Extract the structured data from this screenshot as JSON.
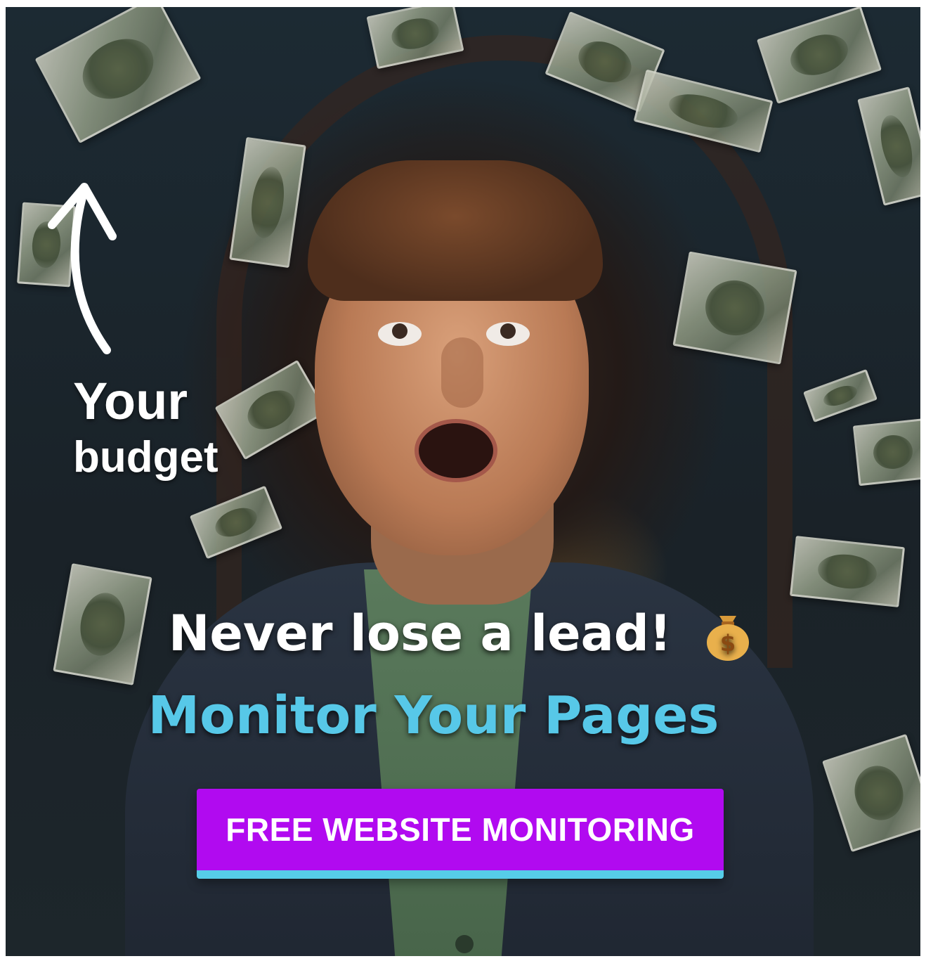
{
  "ad": {
    "arrow_label_line1": "Your",
    "arrow_label_line2": "budget",
    "headline": "Never lose a lead!",
    "headline_emoji": "money-bag",
    "subheadline": "Monitor Your Pages",
    "cta_label": "FREE WEBSITE MONITORING"
  },
  "colors": {
    "subheadline": "#57c8e8",
    "cta_background": "#b10af0",
    "cta_underline": "#56cde8",
    "text": "#ffffff"
  },
  "icons": {
    "arrow": "curved-up-arrow-icon",
    "emoji": "money-bag-icon"
  }
}
